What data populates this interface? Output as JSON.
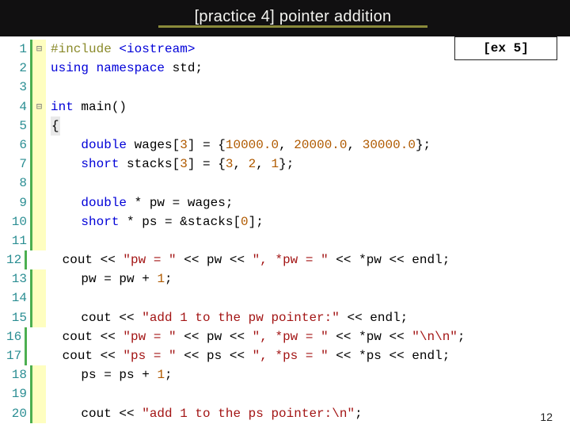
{
  "header": {
    "title": "[practice 4] pointer addition"
  },
  "badge": {
    "label": "[ex 5]"
  },
  "page": {
    "number": "12"
  },
  "code": {
    "lines": [
      {
        "n": "1",
        "mark": "⊟",
        "tokens": [
          [
            "pre",
            "#include "
          ],
          [
            "ty",
            "<iostream>"
          ]
        ]
      },
      {
        "n": "2",
        "mark": "",
        "tokens": [
          [
            "kw",
            "using namespace "
          ],
          [
            "id",
            "std"
          ],
          [
            "sym",
            ";"
          ]
        ]
      },
      {
        "n": "3",
        "mark": "",
        "tokens": []
      },
      {
        "n": "4",
        "mark": "⊟",
        "tokens": [
          [
            "kw",
            "int "
          ],
          [
            "id",
            "main"
          ],
          [
            "sym",
            "()"
          ]
        ]
      },
      {
        "n": "5",
        "mark": "",
        "tokens": [
          [
            "bg",
            "{"
          ],
          [
            "sym",
            ""
          ]
        ]
      },
      {
        "n": "6",
        "mark": "",
        "tokens": [
          [
            "sym",
            "    "
          ],
          [
            "kw",
            "double "
          ],
          [
            "id",
            "wages"
          ],
          [
            "sym",
            "["
          ],
          [
            "num",
            "3"
          ],
          [
            "sym",
            "] = {"
          ],
          [
            "num",
            "10000.0"
          ],
          [
            "sym",
            ", "
          ],
          [
            "num",
            "20000.0"
          ],
          [
            "sym",
            ", "
          ],
          [
            "num",
            "30000.0"
          ],
          [
            "sym",
            "};"
          ]
        ]
      },
      {
        "n": "7",
        "mark": "",
        "tokens": [
          [
            "sym",
            "    "
          ],
          [
            "kw",
            "short "
          ],
          [
            "id",
            "stacks"
          ],
          [
            "sym",
            "["
          ],
          [
            "num",
            "3"
          ],
          [
            "sym",
            "] = {"
          ],
          [
            "num",
            "3"
          ],
          [
            "sym",
            ", "
          ],
          [
            "num",
            "2"
          ],
          [
            "sym",
            ", "
          ],
          [
            "num",
            "1"
          ],
          [
            "sym",
            "};"
          ]
        ]
      },
      {
        "n": "8",
        "mark": "",
        "tokens": []
      },
      {
        "n": "9",
        "mark": "",
        "tokens": [
          [
            "sym",
            "    "
          ],
          [
            "kw",
            "double "
          ],
          [
            "sym",
            "* "
          ],
          [
            "id",
            "pw"
          ],
          [
            "sym",
            " = "
          ],
          [
            "id",
            "wages"
          ],
          [
            "sym",
            ";"
          ]
        ]
      },
      {
        "n": "10",
        "mark": "",
        "tokens": [
          [
            "sym",
            "    "
          ],
          [
            "kw",
            "short "
          ],
          [
            "sym",
            "* "
          ],
          [
            "id",
            "ps"
          ],
          [
            "sym",
            " = &"
          ],
          [
            "id",
            "stacks"
          ],
          [
            "sym",
            "["
          ],
          [
            "num",
            "0"
          ],
          [
            "sym",
            "];"
          ]
        ]
      },
      {
        "n": "11",
        "mark": "",
        "tokens": []
      },
      {
        "n": "12",
        "mark": "",
        "tokens": [
          [
            "sym",
            "    "
          ],
          [
            "id",
            "cout"
          ],
          [
            "sym",
            " << "
          ],
          [
            "str",
            "\"pw = \""
          ],
          [
            "sym",
            " << "
          ],
          [
            "id",
            "pw"
          ],
          [
            "sym",
            " << "
          ],
          [
            "str",
            "\", *pw = \""
          ],
          [
            "sym",
            " << *"
          ],
          [
            "id",
            "pw"
          ],
          [
            "sym",
            " << "
          ],
          [
            "id",
            "endl"
          ],
          [
            "sym",
            ";"
          ]
        ]
      },
      {
        "n": "13",
        "mark": "",
        "tokens": [
          [
            "sym",
            "    "
          ],
          [
            "id",
            "pw"
          ],
          [
            "sym",
            " = "
          ],
          [
            "id",
            "pw"
          ],
          [
            "sym",
            " + "
          ],
          [
            "num",
            "1"
          ],
          [
            "sym",
            ";"
          ]
        ]
      },
      {
        "n": "14",
        "mark": "",
        "tokens": []
      },
      {
        "n": "15",
        "mark": "",
        "tokens": [
          [
            "sym",
            "    "
          ],
          [
            "id",
            "cout"
          ],
          [
            "sym",
            " << "
          ],
          [
            "str",
            "\"add 1 to the pw pointer:\""
          ],
          [
            "sym",
            " << "
          ],
          [
            "id",
            "endl"
          ],
          [
            "sym",
            ";"
          ]
        ]
      },
      {
        "n": "16",
        "mark": "",
        "tokens": [
          [
            "sym",
            "    "
          ],
          [
            "id",
            "cout"
          ],
          [
            "sym",
            " << "
          ],
          [
            "str",
            "\"pw = \""
          ],
          [
            "sym",
            " << "
          ],
          [
            "id",
            "pw"
          ],
          [
            "sym",
            " << "
          ],
          [
            "str",
            "\", *pw = \""
          ],
          [
            "sym",
            " << *"
          ],
          [
            "id",
            "pw"
          ],
          [
            "sym",
            " << "
          ],
          [
            "str",
            "\"\\n\\n\""
          ],
          [
            "sym",
            ";"
          ]
        ]
      },
      {
        "n": "17",
        "mark": "",
        "tokens": [
          [
            "sym",
            "    "
          ],
          [
            "id",
            "cout"
          ],
          [
            "sym",
            " << "
          ],
          [
            "str",
            "\"ps = \""
          ],
          [
            "sym",
            " << "
          ],
          [
            "id",
            "ps"
          ],
          [
            "sym",
            " << "
          ],
          [
            "str",
            "\", *ps = \""
          ],
          [
            "sym",
            " << *"
          ],
          [
            "id",
            "ps"
          ],
          [
            "sym",
            " << "
          ],
          [
            "id",
            "endl"
          ],
          [
            "sym",
            ";"
          ]
        ]
      },
      {
        "n": "18",
        "mark": "",
        "tokens": [
          [
            "sym",
            "    "
          ],
          [
            "id",
            "ps"
          ],
          [
            "sym",
            " = "
          ],
          [
            "id",
            "ps"
          ],
          [
            "sym",
            " + "
          ],
          [
            "num",
            "1"
          ],
          [
            "sym",
            ";"
          ]
        ]
      },
      {
        "n": "19",
        "mark": "",
        "tokens": []
      },
      {
        "n": "20",
        "mark": "",
        "tokens": [
          [
            "sym",
            "    "
          ],
          [
            "id",
            "cout"
          ],
          [
            "sym",
            " << "
          ],
          [
            "str",
            "\"add 1 to the ps pointer:\\n\""
          ],
          [
            "sym",
            ";"
          ]
        ]
      }
    ]
  }
}
